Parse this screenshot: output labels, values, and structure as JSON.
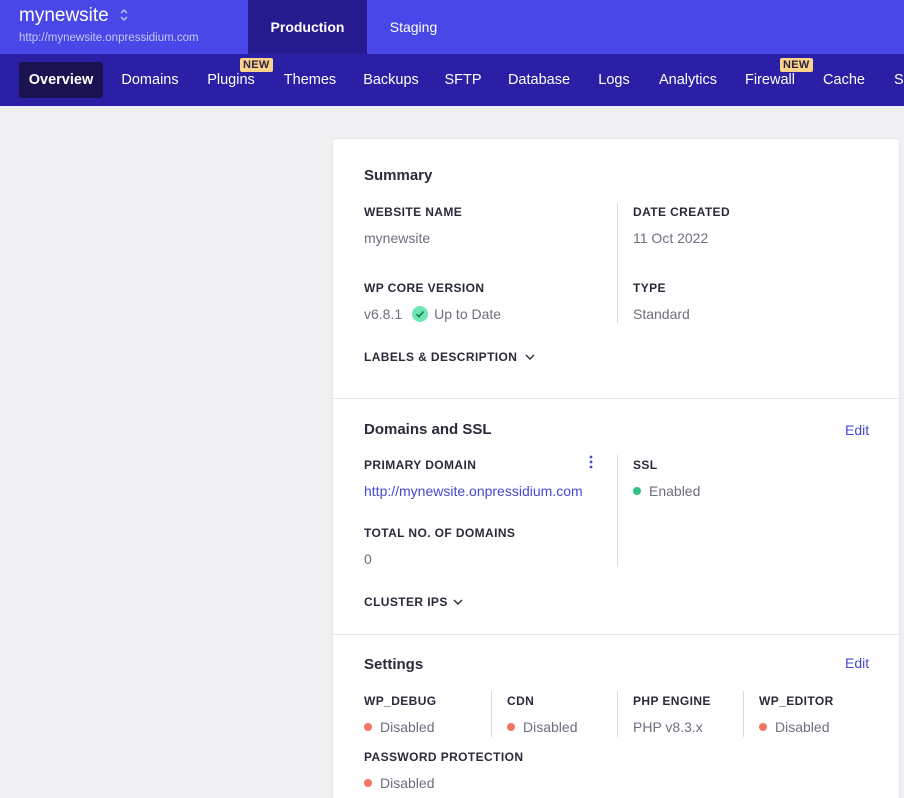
{
  "header": {
    "site_name": "mynewsite",
    "site_url": "http://mynewsite.onpressidium.com",
    "env_tabs": [
      {
        "label": "Production",
        "active": true
      },
      {
        "label": "Staging",
        "active": false
      }
    ]
  },
  "nav": {
    "items": [
      {
        "label": "Overview",
        "active": true
      },
      {
        "label": "Domains"
      },
      {
        "label": "Plugins",
        "badge": "NEW"
      },
      {
        "label": "Themes"
      },
      {
        "label": "Backups"
      },
      {
        "label": "SFTP"
      },
      {
        "label": "Database"
      },
      {
        "label": "Logs"
      },
      {
        "label": "Analytics"
      },
      {
        "label": "Firewall",
        "badge": "NEW"
      },
      {
        "label": "Cache"
      },
      {
        "label": "Se"
      }
    ]
  },
  "summary": {
    "title": "Summary",
    "website_name_label": "WEBSITE NAME",
    "website_name_value": "mynewsite",
    "date_created_label": "DATE CREATED",
    "date_created_value": "11 Oct 2022",
    "wp_core_label": "WP CORE VERSION",
    "wp_core_value": "v6.8.1",
    "wp_core_status": "Up to Date",
    "type_label": "TYPE",
    "type_value": "Standard",
    "labels_desc": "LABELS & DESCRIPTION"
  },
  "domains": {
    "title": "Domains and SSL",
    "edit_label": "Edit",
    "primary_domain_label": "PRIMARY DOMAIN",
    "primary_domain_value": "http://mynewsite.onpressidium.com",
    "ssl_label": "SSL",
    "ssl_value": "Enabled",
    "total_domains_label": "TOTAL NO. OF DOMAINS",
    "total_domains_value": "0",
    "cluster_ips": "CLUSTER IPS"
  },
  "settings": {
    "title": "Settings",
    "edit_label": "Edit",
    "wp_debug_label": "WP_DEBUG",
    "wp_debug_value": "Disabled",
    "cdn_label": "CDN",
    "cdn_value": "Disabled",
    "php_engine_label": "PHP ENGINE",
    "php_engine_value": "PHP v8.3.x",
    "wp_editor_label": "WP_EDITOR",
    "wp_editor_value": "Disabled",
    "password_label": "PASSWORD PROTECTION",
    "password_value": "Disabled"
  },
  "colors": {
    "header_bg": "#4a47e8",
    "active_env_bg": "#261a8f",
    "nav_bg": "#2a1fa5",
    "active_nav_bg": "#1a1350",
    "badge_bg": "#fbd38a",
    "link": "#4548d1",
    "status_disabled": "#ef7564",
    "status_enabled": "#2fc18a"
  }
}
